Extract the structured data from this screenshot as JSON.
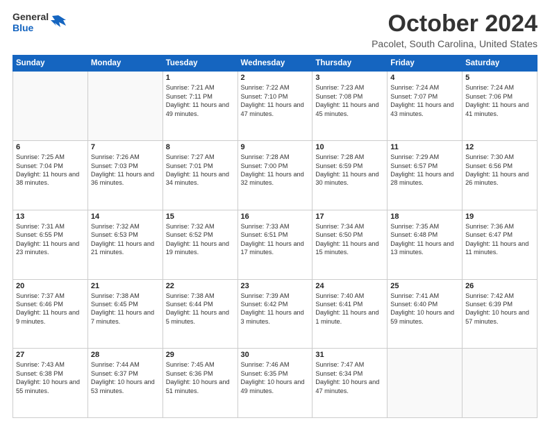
{
  "header": {
    "logo_general": "General",
    "logo_blue": "Blue",
    "month_title": "October 2024",
    "location": "Pacolet, South Carolina, United States"
  },
  "days_of_week": [
    "Sunday",
    "Monday",
    "Tuesday",
    "Wednesday",
    "Thursday",
    "Friday",
    "Saturday"
  ],
  "weeks": [
    [
      {
        "day": "",
        "info": ""
      },
      {
        "day": "",
        "info": ""
      },
      {
        "day": "1",
        "info": "Sunrise: 7:21 AM\nSunset: 7:11 PM\nDaylight: 11 hours and 49 minutes."
      },
      {
        "day": "2",
        "info": "Sunrise: 7:22 AM\nSunset: 7:10 PM\nDaylight: 11 hours and 47 minutes."
      },
      {
        "day": "3",
        "info": "Sunrise: 7:23 AM\nSunset: 7:08 PM\nDaylight: 11 hours and 45 minutes."
      },
      {
        "day": "4",
        "info": "Sunrise: 7:24 AM\nSunset: 7:07 PM\nDaylight: 11 hours and 43 minutes."
      },
      {
        "day": "5",
        "info": "Sunrise: 7:24 AM\nSunset: 7:06 PM\nDaylight: 11 hours and 41 minutes."
      }
    ],
    [
      {
        "day": "6",
        "info": "Sunrise: 7:25 AM\nSunset: 7:04 PM\nDaylight: 11 hours and 38 minutes."
      },
      {
        "day": "7",
        "info": "Sunrise: 7:26 AM\nSunset: 7:03 PM\nDaylight: 11 hours and 36 minutes."
      },
      {
        "day": "8",
        "info": "Sunrise: 7:27 AM\nSunset: 7:01 PM\nDaylight: 11 hours and 34 minutes."
      },
      {
        "day": "9",
        "info": "Sunrise: 7:28 AM\nSunset: 7:00 PM\nDaylight: 11 hours and 32 minutes."
      },
      {
        "day": "10",
        "info": "Sunrise: 7:28 AM\nSunset: 6:59 PM\nDaylight: 11 hours and 30 minutes."
      },
      {
        "day": "11",
        "info": "Sunrise: 7:29 AM\nSunset: 6:57 PM\nDaylight: 11 hours and 28 minutes."
      },
      {
        "day": "12",
        "info": "Sunrise: 7:30 AM\nSunset: 6:56 PM\nDaylight: 11 hours and 26 minutes."
      }
    ],
    [
      {
        "day": "13",
        "info": "Sunrise: 7:31 AM\nSunset: 6:55 PM\nDaylight: 11 hours and 23 minutes."
      },
      {
        "day": "14",
        "info": "Sunrise: 7:32 AM\nSunset: 6:53 PM\nDaylight: 11 hours and 21 minutes."
      },
      {
        "day": "15",
        "info": "Sunrise: 7:32 AM\nSunset: 6:52 PM\nDaylight: 11 hours and 19 minutes."
      },
      {
        "day": "16",
        "info": "Sunrise: 7:33 AM\nSunset: 6:51 PM\nDaylight: 11 hours and 17 minutes."
      },
      {
        "day": "17",
        "info": "Sunrise: 7:34 AM\nSunset: 6:50 PM\nDaylight: 11 hours and 15 minutes."
      },
      {
        "day": "18",
        "info": "Sunrise: 7:35 AM\nSunset: 6:48 PM\nDaylight: 11 hours and 13 minutes."
      },
      {
        "day": "19",
        "info": "Sunrise: 7:36 AM\nSunset: 6:47 PM\nDaylight: 11 hours and 11 minutes."
      }
    ],
    [
      {
        "day": "20",
        "info": "Sunrise: 7:37 AM\nSunset: 6:46 PM\nDaylight: 11 hours and 9 minutes."
      },
      {
        "day": "21",
        "info": "Sunrise: 7:38 AM\nSunset: 6:45 PM\nDaylight: 11 hours and 7 minutes."
      },
      {
        "day": "22",
        "info": "Sunrise: 7:38 AM\nSunset: 6:44 PM\nDaylight: 11 hours and 5 minutes."
      },
      {
        "day": "23",
        "info": "Sunrise: 7:39 AM\nSunset: 6:42 PM\nDaylight: 11 hours and 3 minutes."
      },
      {
        "day": "24",
        "info": "Sunrise: 7:40 AM\nSunset: 6:41 PM\nDaylight: 11 hours and 1 minute."
      },
      {
        "day": "25",
        "info": "Sunrise: 7:41 AM\nSunset: 6:40 PM\nDaylight: 10 hours and 59 minutes."
      },
      {
        "day": "26",
        "info": "Sunrise: 7:42 AM\nSunset: 6:39 PM\nDaylight: 10 hours and 57 minutes."
      }
    ],
    [
      {
        "day": "27",
        "info": "Sunrise: 7:43 AM\nSunset: 6:38 PM\nDaylight: 10 hours and 55 minutes."
      },
      {
        "day": "28",
        "info": "Sunrise: 7:44 AM\nSunset: 6:37 PM\nDaylight: 10 hours and 53 minutes."
      },
      {
        "day": "29",
        "info": "Sunrise: 7:45 AM\nSunset: 6:36 PM\nDaylight: 10 hours and 51 minutes."
      },
      {
        "day": "30",
        "info": "Sunrise: 7:46 AM\nSunset: 6:35 PM\nDaylight: 10 hours and 49 minutes."
      },
      {
        "day": "31",
        "info": "Sunrise: 7:47 AM\nSunset: 6:34 PM\nDaylight: 10 hours and 47 minutes."
      },
      {
        "day": "",
        "info": ""
      },
      {
        "day": "",
        "info": ""
      }
    ]
  ]
}
